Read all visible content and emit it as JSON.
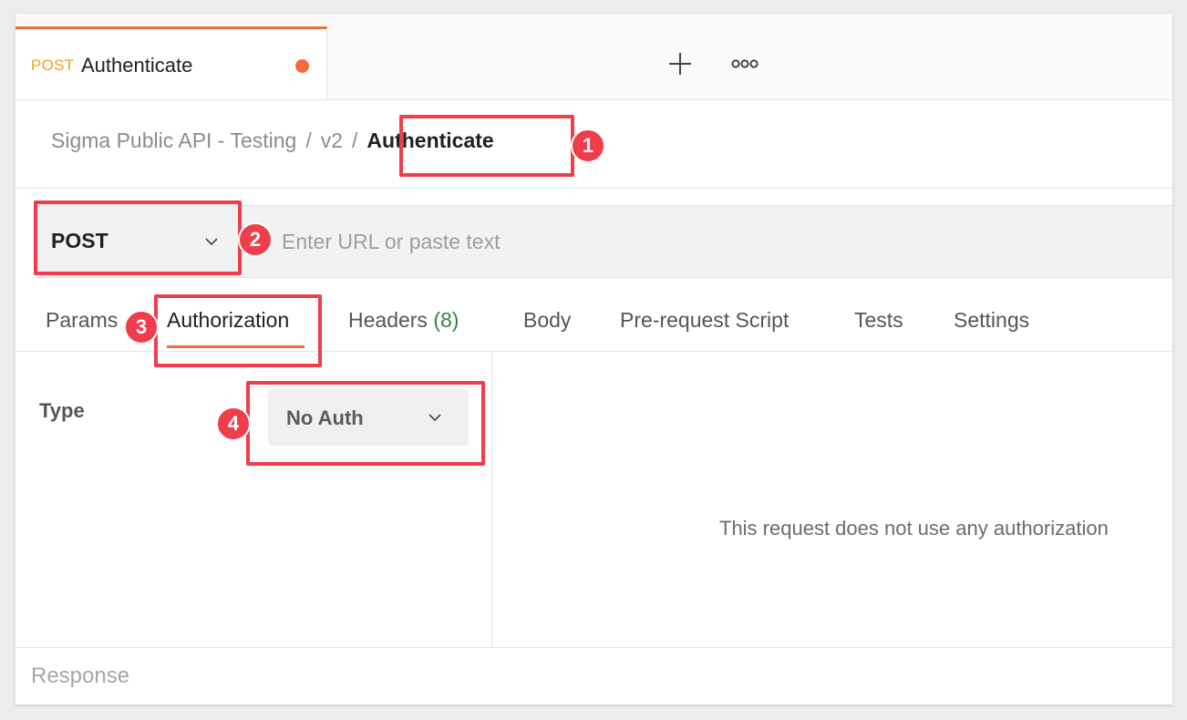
{
  "tab": {
    "method": "POST",
    "name": "Authenticate",
    "unsaved_indicator_color": "#f26b3a"
  },
  "toolbar": {
    "new_tab_icon": "plus-icon",
    "more_icon": "more-options-icon"
  },
  "breadcrumb": {
    "items": [
      "Sigma Public API - Testing",
      "v2"
    ],
    "separator": "/",
    "current": "Authenticate"
  },
  "request": {
    "method": "POST",
    "url_value": "",
    "url_placeholder": "Enter URL or paste text"
  },
  "request_tabs": {
    "params": "Params",
    "authorization": "Authorization",
    "headers": "Headers",
    "headers_count": "(8)",
    "body": "Body",
    "pre_request_script": "Pre-request Script",
    "tests": "Tests",
    "settings": "Settings",
    "active": "Authorization"
  },
  "auth": {
    "type_label": "Type",
    "selected_type": "No Auth",
    "message": "This request does not use any authorization"
  },
  "response": {
    "label": "Response"
  },
  "annotations": [
    "1",
    "2",
    "3",
    "4"
  ],
  "colors": {
    "accent": "#f26b3a",
    "method_post": "#f0a020",
    "annotation": "#ef3d4c",
    "headers_count": "#2e8540"
  }
}
